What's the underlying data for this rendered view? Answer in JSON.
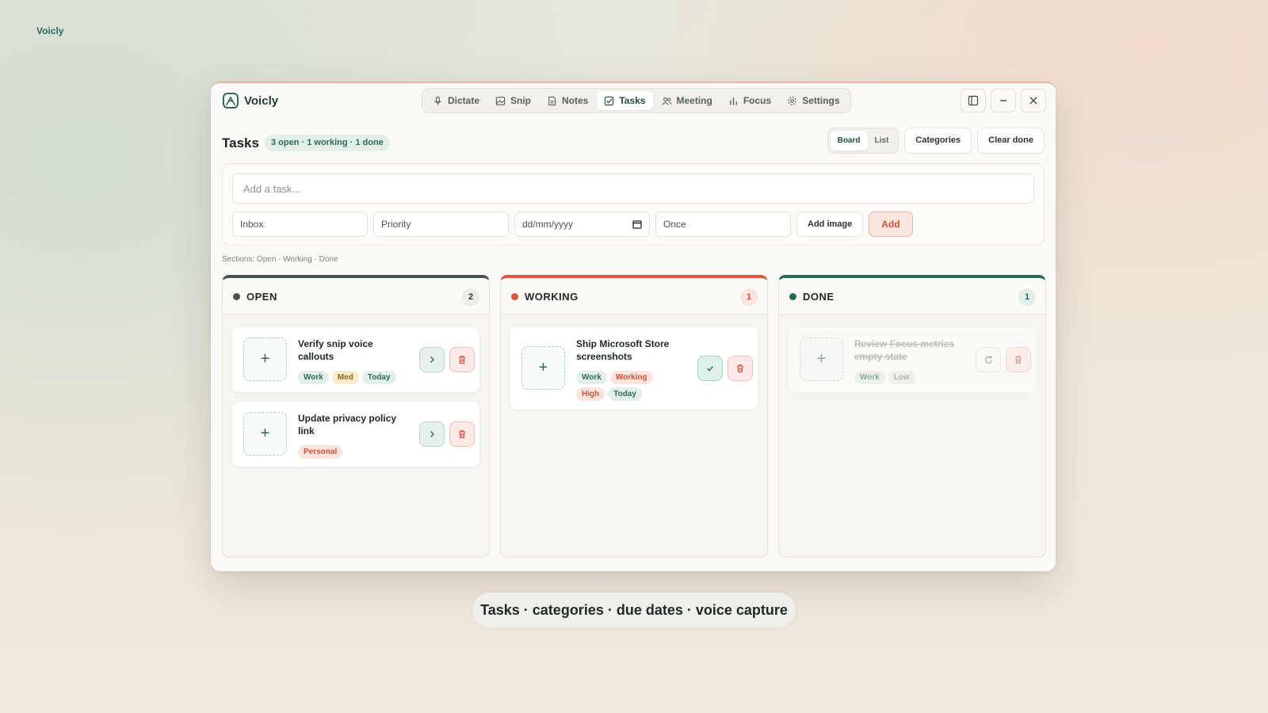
{
  "corner_brand": "Voicly",
  "app": {
    "name": "Voicly"
  },
  "nav": [
    {
      "label": "Dictate",
      "icon": "mic-icon"
    },
    {
      "label": "Snip",
      "icon": "image-icon"
    },
    {
      "label": "Notes",
      "icon": "note-icon"
    },
    {
      "label": "Tasks",
      "icon": "task-check-icon",
      "active": true
    },
    {
      "label": "Meeting",
      "icon": "users-icon"
    },
    {
      "label": "Focus",
      "icon": "bar-chart-icon"
    },
    {
      "label": "Settings",
      "icon": "gear-icon"
    }
  ],
  "header": {
    "title": "Tasks",
    "summary": "3 open · 1 working · 1 done",
    "view_board": "Board",
    "view_list": "List",
    "categories": "Categories",
    "clear_done": "Clear done"
  },
  "composer": {
    "placeholder": "Add a task...",
    "category": "Inbox",
    "priority": "Priority",
    "date": "dd/mm/yyyy",
    "repeat": "Once",
    "add_image": "Add image",
    "add": "Add"
  },
  "sections_note": "Sections: Open · Working · Done",
  "columns": {
    "open": {
      "title": "OPEN",
      "count": "2",
      "color": "#4a5350",
      "cards": [
        {
          "title": "Verify snip voice callouts",
          "tags": [
            "Work",
            "Med",
            "Today"
          ]
        },
        {
          "title": "Update privacy policy link",
          "tags": [
            "Personal"
          ]
        }
      ]
    },
    "working": {
      "title": "WORKING",
      "count": "1",
      "color": "#e0573e",
      "cards": [
        {
          "title": "Ship Microsoft Store screenshots",
          "tags": [
            "Work",
            "Working",
            "High",
            "Today"
          ]
        }
      ]
    },
    "done": {
      "title": "DONE",
      "count": "1",
      "color": "#256d58",
      "cards": [
        {
          "title": "Review Focus metrics empty state",
          "tags": [
            "Work",
            "Low"
          ]
        }
      ]
    }
  },
  "caption": "Tasks · categories · due dates · voice capture"
}
